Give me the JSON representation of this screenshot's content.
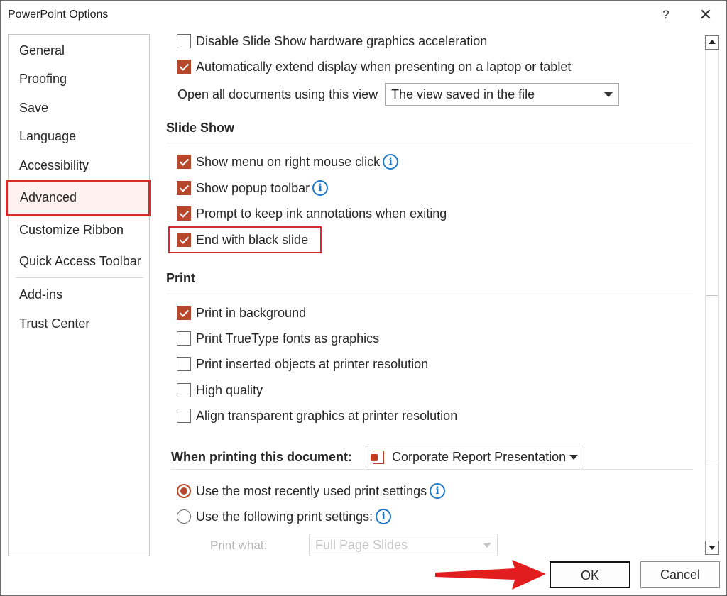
{
  "window": {
    "title": "PowerPoint Options",
    "help_label": "?",
    "close_label": "✕"
  },
  "sidebar": {
    "items": [
      {
        "label": "General"
      },
      {
        "label": "Proofing"
      },
      {
        "label": "Save"
      },
      {
        "label": "Language"
      },
      {
        "label": "Accessibility"
      },
      {
        "label": "Advanced",
        "selected": true
      },
      {
        "label": "Customize Ribbon"
      },
      {
        "label": "Quick Access Toolbar"
      },
      {
        "label": "Add-ins"
      },
      {
        "label": "Trust Center"
      }
    ]
  },
  "display": {
    "disable_hw_accel": {
      "label": "Disable Slide Show hardware graphics acceleration",
      "checked": false
    },
    "auto_extend": {
      "label": "Automatically extend display when presenting on a laptop or tablet",
      "checked": true
    },
    "open_view_label": "Open all documents using this view",
    "open_view_value": "The view saved in the file"
  },
  "slide_show": {
    "title": "Slide Show",
    "show_menu": {
      "label": "Show menu on right mouse click",
      "checked": true
    },
    "show_popup": {
      "label": "Show popup toolbar",
      "checked": true
    },
    "prompt_ink": {
      "label": "Prompt to keep ink annotations when exiting",
      "checked": true
    },
    "end_black": {
      "label": "End with black slide",
      "checked": true
    }
  },
  "print": {
    "title": "Print",
    "background": {
      "label": "Print in background",
      "checked": true
    },
    "truetype": {
      "label": "Print TrueType fonts as graphics",
      "checked": false
    },
    "inserted_objects": {
      "label": "Print inserted objects at printer resolution",
      "checked": false
    },
    "high_quality": {
      "label": "High quality",
      "checked": false
    },
    "align_transparent": {
      "label": "Align transparent graphics at printer resolution",
      "checked": false
    }
  },
  "when_printing": {
    "title": "When printing this document:",
    "document_value": "Corporate Report Presentation",
    "recent_settings": {
      "label": "Use the most recently used print settings",
      "selected": true
    },
    "following_settings": {
      "label": "Use the following print settings:",
      "selected": false
    },
    "print_what_label": "Print what:",
    "print_what_value": "Full Page Slides"
  },
  "footer": {
    "ok_label": "OK",
    "cancel_label": "Cancel"
  },
  "colors": {
    "accent": "#b7472a",
    "highlight": "#d52b2b",
    "info": "#1f78c8"
  },
  "icons": [
    "close-icon",
    "help-icon",
    "info-icon",
    "powerpoint-file-icon",
    "dropdown-arrow-icon",
    "scroll-up-icon",
    "scroll-down-icon",
    "red-arrow-icon"
  ]
}
